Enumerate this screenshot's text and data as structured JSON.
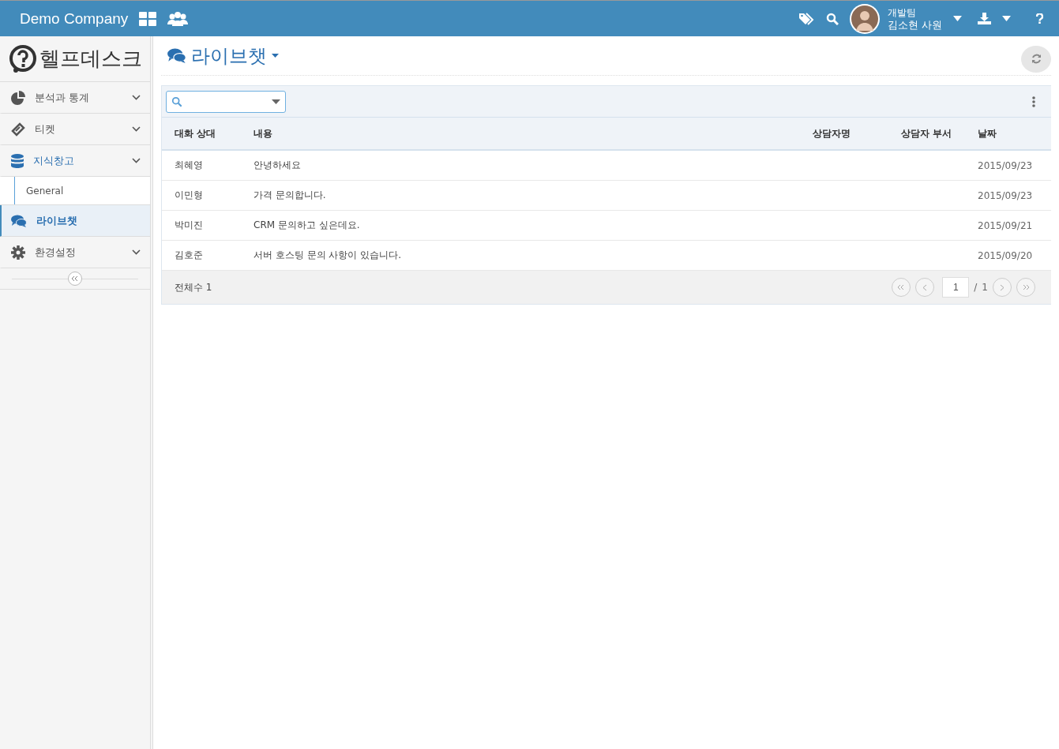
{
  "topbar": {
    "brand": "Demo Company",
    "user": {
      "team": "개발팀",
      "name": "김소현 사원"
    }
  },
  "sidebar": {
    "logo": "헬프데스크",
    "items": [
      {
        "label": "분석과 통계",
        "kind": "menu",
        "expanded": false,
        "selected": false
      },
      {
        "label": "티켓",
        "kind": "menu",
        "expanded": false,
        "selected": false
      },
      {
        "label": "지식창고",
        "kind": "menu",
        "expanded": true,
        "selected": false,
        "children": [
          {
            "label": "General"
          }
        ]
      },
      {
        "label": "라이브챗",
        "kind": "link",
        "expanded": false,
        "selected": true
      },
      {
        "label": "환경설정",
        "kind": "menu",
        "expanded": false,
        "selected": false
      }
    ]
  },
  "page": {
    "title": "라이브챗"
  },
  "table": {
    "columns": [
      "대화 상대",
      "내용",
      "상담자명",
      "상담자 부서",
      "날짜"
    ],
    "rows": [
      {
        "partner": "최혜영",
        "content": "안녕하세요",
        "date": "2015/09/23"
      },
      {
        "partner": "이민형",
        "content": "가격 문의합니다.",
        "date": "2015/09/23"
      },
      {
        "partner": "박미진",
        "content": "CRM 문의하고 싶은데요.",
        "date": "2015/09/21"
      },
      {
        "partner": "김호준",
        "content": "서버 호스팅 문의 사항이 있습니다.",
        "date": "2015/09/20"
      }
    ]
  },
  "footer": {
    "total": "전체수 1",
    "page": "1",
    "separator": "/",
    "pages": "1"
  }
}
